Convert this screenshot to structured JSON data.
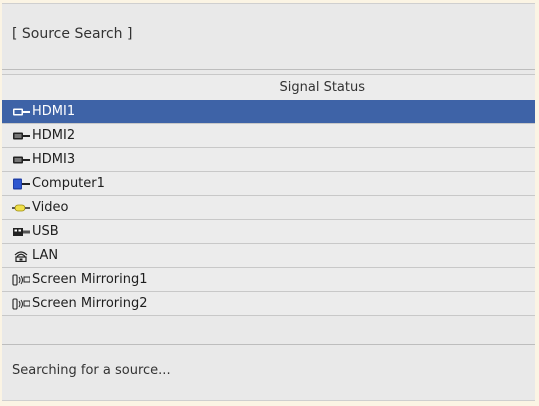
{
  "window": {
    "title": "[ Source Search ]"
  },
  "table": {
    "column_header": "Signal Status",
    "sources": [
      {
        "label": "HDMI1",
        "icon": "hdmi-icon",
        "selected": true
      },
      {
        "label": "HDMI2",
        "icon": "hdmi-icon",
        "selected": false
      },
      {
        "label": "HDMI3",
        "icon": "hdmi-icon",
        "selected": false
      },
      {
        "label": "Computer1",
        "icon": "computer-vga-icon",
        "selected": false
      },
      {
        "label": "Video",
        "icon": "video-rca-icon",
        "selected": false
      },
      {
        "label": "USB",
        "icon": "usb-icon",
        "selected": false
      },
      {
        "label": "LAN",
        "icon": "lan-icon",
        "selected": false
      },
      {
        "label": "Screen Mirroring1",
        "icon": "screen-mirroring-icon",
        "selected": false
      },
      {
        "label": "Screen Mirroring2",
        "icon": "screen-mirroring-icon",
        "selected": false
      }
    ]
  },
  "status": {
    "message": "Searching for a source..."
  },
  "colors": {
    "selected_row": "#3e63a7",
    "panel_bg": "#e9e9e9",
    "page_bg": "#fbf4e4"
  }
}
